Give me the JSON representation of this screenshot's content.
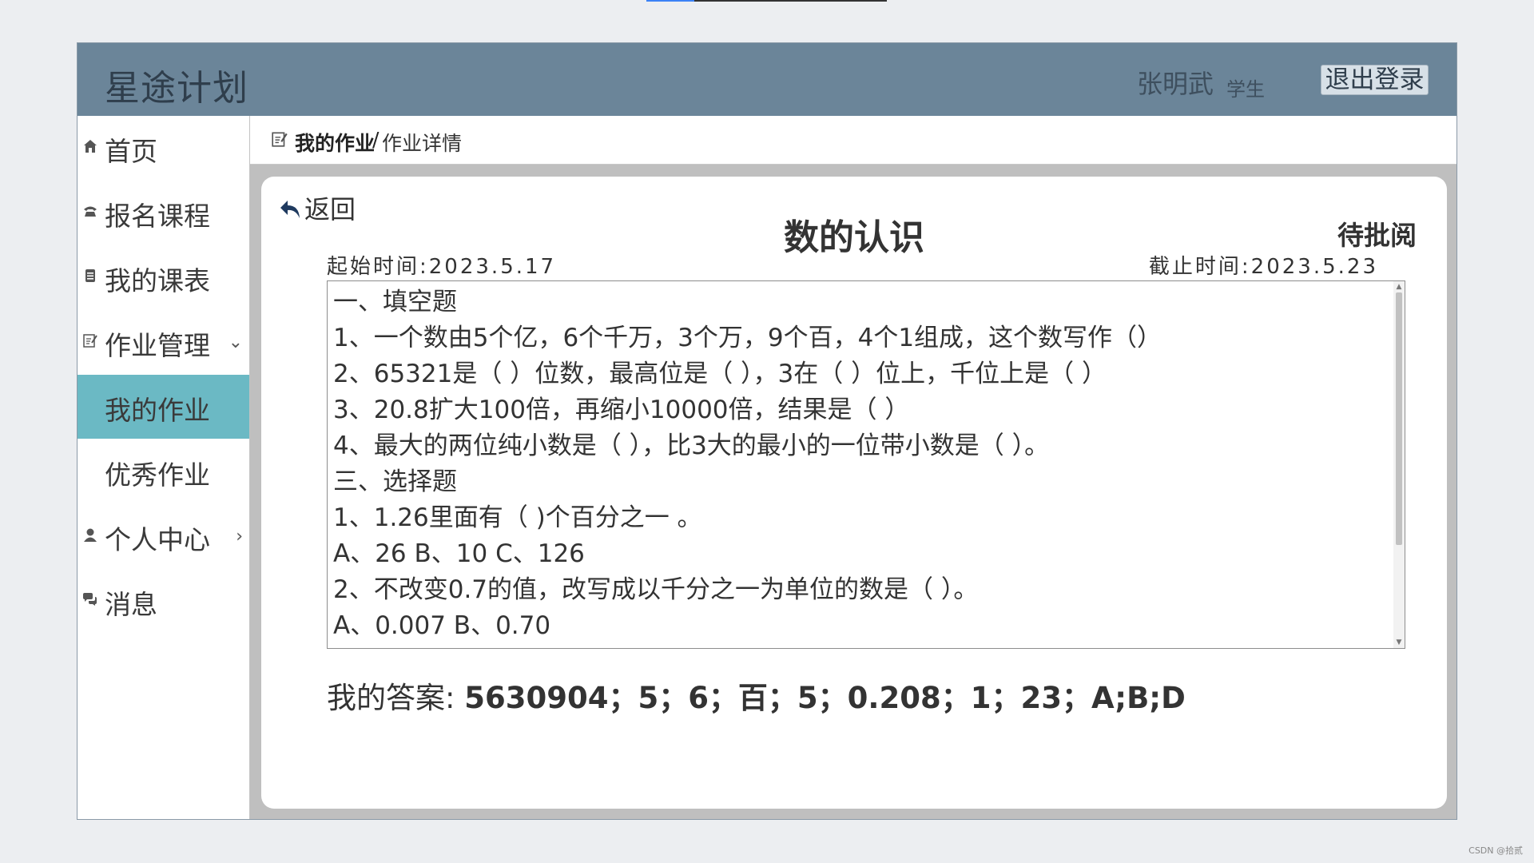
{
  "app": {
    "brand": "星途计划"
  },
  "user": {
    "name": "张明武",
    "role": "学生",
    "logout_label": "退出登录"
  },
  "sidebar": {
    "items": [
      {
        "label": "首页",
        "icon": "home-icon"
      },
      {
        "label": "报名课程",
        "icon": "phone-icon"
      },
      {
        "label": "我的课表",
        "icon": "list-icon"
      },
      {
        "label": "作业管理",
        "icon": "edit-icon",
        "expanded": true
      },
      {
        "label": "我的作业",
        "active": true
      },
      {
        "label": "优秀作业"
      },
      {
        "label": "个人中心",
        "icon": "user-icon",
        "expanded": false
      },
      {
        "label": "消息",
        "icon": "chat-icon"
      }
    ],
    "active_color": "#6bb9c4"
  },
  "breadcrumb": {
    "parent": "我的作业",
    "separator": "/",
    "current": "作业详情"
  },
  "homework": {
    "back_label": "返回",
    "title": "数的认识",
    "status": "待批阅",
    "start_time": "起始时间:2023.5.17",
    "end_time": "截止时间:2023.5.23",
    "questions": [
      "一、填空题",
      "1、一个数由5个亿，6个千万，3个万，9个百，4个1组成，这个数写作（）",
      "2、65321是（      ）位数，最高位是（      ），3在（      ）位上，千位上是（      ）",
      "3、20.8扩大100倍，再缩小10000倍，结果是（         ）",
      "4、最大的两位纯小数是（      ），比3大的最小的一位带小数是（      ）。",
      "三、选择题",
      "1、1.26里面有（   )个百分之一 。",
      "A、26          B、10            C、126",
      "2、不改变0.7的值，改写成以千分之一为单位的数是（    ）。",
      "A、0.007          B、0.70"
    ],
    "answer_label": "我的答案:",
    "answer_value": "5630904；5；6；百；5；0.208；1；23；A;B;D"
  },
  "colors": {
    "header_bg": "#6b8599",
    "content_bg": "#bfbfbf"
  },
  "watermark": "CSDN @拾贰"
}
